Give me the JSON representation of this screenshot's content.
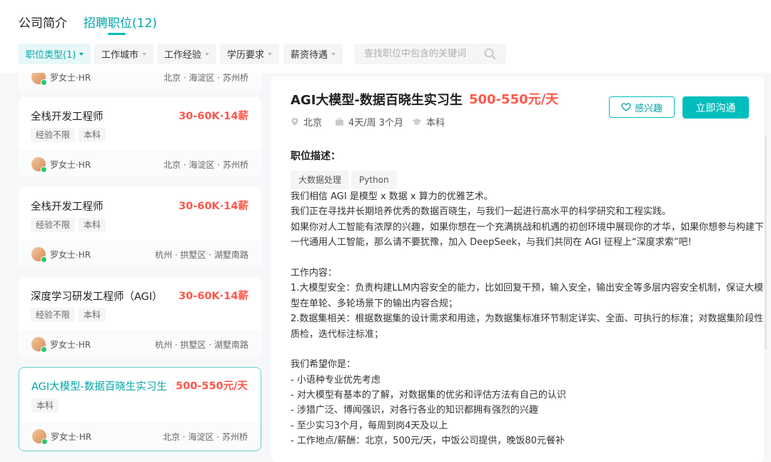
{
  "tabs": [
    {
      "label": "公司简介"
    },
    {
      "label": "招聘职位(12)"
    }
  ],
  "filters": [
    {
      "label": "职位类型(1)"
    },
    {
      "label": "工作城市"
    },
    {
      "label": "工作经验"
    },
    {
      "label": "学历要求"
    },
    {
      "label": "薪资待遇"
    }
  ],
  "search": {
    "placeholder": "查找职位中包含的关键词"
  },
  "job_list": [
    {
      "recruiter": "罗女士·HR",
      "location": "北京 · 海淀区 · 苏州桥"
    },
    {
      "title": "全栈开发工程师",
      "salary": "30-60K·14薪",
      "tags": [
        "经验不限",
        "本科"
      ],
      "recruiter": "罗女士·HR",
      "location": "北京 · 海淀区 · 苏州桥"
    },
    {
      "title": "全栈开发工程师",
      "salary": "30-60K·14薪",
      "tags": [
        "经验不限",
        "本科"
      ],
      "recruiter": "罗女士·HR",
      "location": "杭州 · 拱墅区 · 湖墅南路"
    },
    {
      "title": "深度学习研发工程师（AGI）",
      "salary": "30-60K·14薪",
      "tags": [
        "经验不限",
        "本科"
      ],
      "recruiter": "罗女士·HR",
      "location": "杭州 · 拱墅区 · 湖墅南路"
    },
    {
      "title": "AGI大模型-数据百晓生实习生",
      "salary": "500-550元/天",
      "tags": [
        "本科"
      ],
      "recruiter": "罗女士·HR",
      "location": "北京 · 海淀区 · 苏州桥"
    }
  ],
  "detail": {
    "title": "AGI大模型-数据百晓生实习生",
    "salary": "500-550元/天",
    "city": "北京",
    "schedule": "4天/周 3个月",
    "degree": "本科",
    "like_label": "感兴趣",
    "chat_label": "立即沟通",
    "section_title": "职位描述：",
    "skills": [
      "大数据处理",
      "Python"
    ],
    "lines": [
      "我们相信 AGI 是模型 x 数据 x 算力的优雅艺术。",
      "我们正在寻找并长期培养优秀的数据百晓生，与我们一起进行高水平的科学研究和工程实践。",
      "如果你对人工智能有浓厚的兴趣，如果你想在一个充满挑战和机遇的初创环境中展现你的才华，如果你想参与构建下",
      "一代通用人工智能，那么请不要犹豫，加入 DeepSeek，与我们共同在 AGI 征程上“深度求索”吧!",
      "",
      "工作内容：",
      "1.大模型安全：负责构建LLM内容安全的能力，比如回复干预，输入安全，输出安全等多层内容安全机制，保证大模",
      "型在单轮、多轮场景下的输出内容合规；",
      "2.数据集相关：根据数据集的设计需求和用途，为数据集标准环节制定详实、全面、可执行的标准；对数据集阶段性",
      "质检，迭代标注标准；",
      "",
      "我们希望你是：",
      "- 小语种专业优先考虑",
      "- 对大模型有基本的了解，对数据集的优劣和评估方法有自己的认识",
      "- 涉猎广泛、博闻强识，对各行各业的知识都拥有强烈的兴趣",
      "- 至少实习3个月，每周到岗4天及以上",
      "- 工作地点/薪酬：北京，500元/天，中饭公司提供，晚饭80元餐补"
    ]
  },
  "colors": {
    "accent": "#00bebd",
    "salary": "#fe574a"
  }
}
